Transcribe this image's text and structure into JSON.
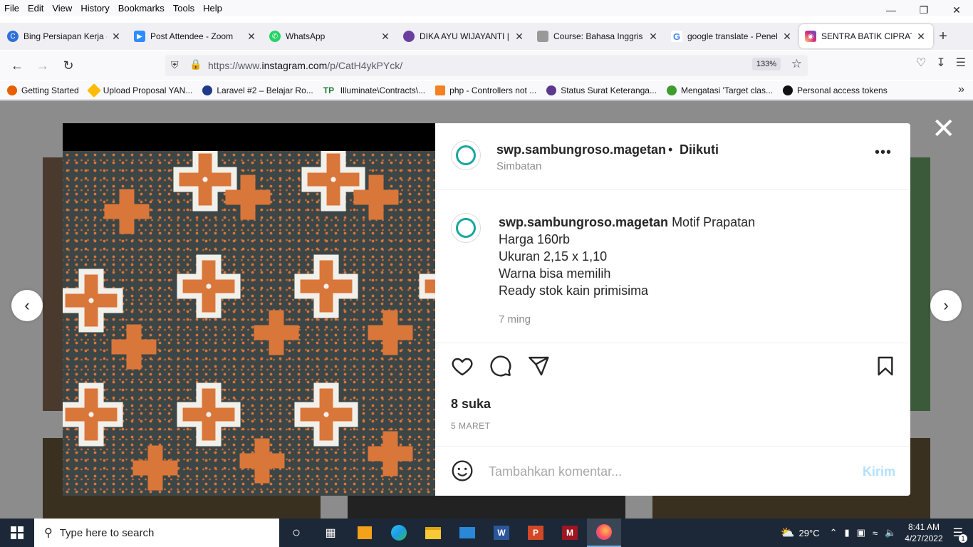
{
  "menu": [
    "File",
    "Edit",
    "View",
    "History",
    "Bookmarks",
    "Tools",
    "Help"
  ],
  "tabs": [
    {
      "label": "Bing Persiapan Kerja - Pré",
      "color": "#2f6fd8"
    },
    {
      "label": "Post Attendee - Zoom",
      "color": "#2d8cff"
    },
    {
      "label": "WhatsApp",
      "color": "#25d366"
    },
    {
      "label": "DIKA AYU WIJAYANTI | Sp",
      "color": "#6b3fa0"
    },
    {
      "label": "Course: Bahasa Inggris Pe",
      "color": "#888888"
    },
    {
      "label": "google translate - Penelu",
      "color": "#4285f4"
    },
    {
      "label": "SENTRA BATIK CIPRAT",
      "color": "#d6249f"
    }
  ],
  "url": {
    "prefix": "https://www.",
    "domain": "instagram.com",
    "path": "/p/CatH4ykPYck/"
  },
  "zoom": "133%",
  "bookmarks": [
    {
      "label": "Getting Started",
      "color": "#e66000"
    },
    {
      "label": "Upload Proposal YAN...",
      "color": "#fbbc04"
    },
    {
      "label": "Laravel #2 – Belajar Ro...",
      "color": "#1e3a8a"
    },
    {
      "label": "Illuminate\\Contracts\\...",
      "color": "#1a7f37"
    },
    {
      "label": "php - Controllers not ...",
      "color": "#f48024"
    },
    {
      "label": "Status Surat Keteranga...",
      "color": "#5b3a8c"
    },
    {
      "label": "Mengatasi 'Target clas...",
      "color": "#3f9d2f"
    },
    {
      "label": "Personal access tokens",
      "color": "#111111"
    }
  ],
  "post": {
    "username": "swp.sambungroso.magetan",
    "follow_status": "Diikuti",
    "location": "Simbatan",
    "caption_user": "swp.sambungroso.magetan",
    "caption_lines": [
      "Motif Prapatan",
      "Harga 160rb",
      "Ukuran 2,15 x 1,10",
      "Warna bisa memilih",
      "Ready stok kain primisima"
    ],
    "time_ago": "7 ming",
    "likes": "8 suka",
    "date": "5 MARET",
    "comment_placeholder": "Tambahkan komentar...",
    "send_label": "Kirim"
  },
  "taskbar": {
    "search_placeholder": "Type here to search",
    "temperature": "29°C",
    "time": "8:41 AM",
    "date": "4/27/2022",
    "notifications": "1"
  },
  "colors": {
    "accent": "#0095f6",
    "batik_orange": "#d9763a",
    "batik_bg": "#3d4646"
  }
}
